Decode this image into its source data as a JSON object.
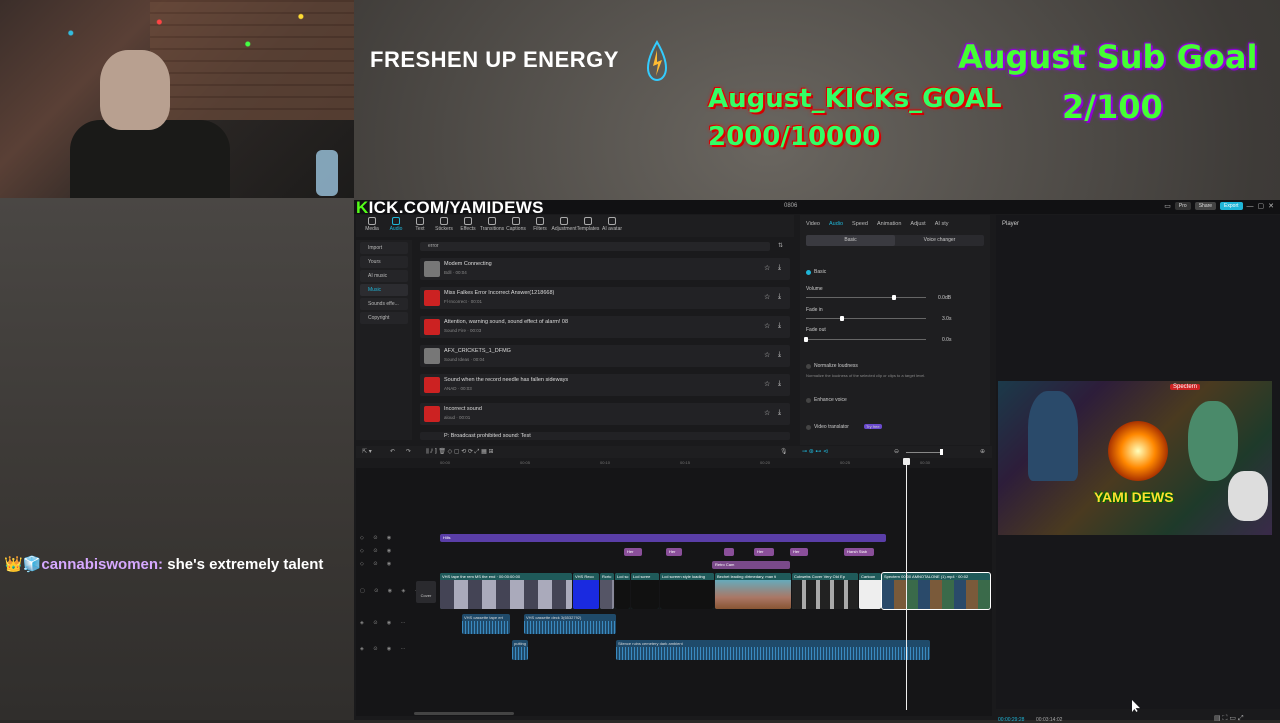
{
  "overlay": {
    "brand": "FRESHEN UP ENERGY",
    "kicks_goal_title": "August_KICKs_GOAL",
    "kicks_goal_value": "2000/10000",
    "sub_goal_title": "August Sub Goal",
    "sub_goal_value": "2/100",
    "kick_url_k": "K",
    "kick_url_rest": "ICK.COM/YAMIDEWS",
    "chat": {
      "badges": "👑🧊",
      "user": "cannabiswomen:",
      "message": " she's extremely talent"
    }
  },
  "editor": {
    "title": "0806",
    "top_buttons": {
      "pro": "Pro",
      "share": "Share",
      "export": "Export"
    },
    "toolbar": [
      "Media",
      "Audio",
      "Text",
      "Stickers",
      "Effects",
      "Transitions",
      "Captions",
      "Filters",
      "Adjustment",
      "Templates",
      "AI avatar"
    ],
    "sidebar": [
      "Import",
      "Yours",
      "AI music",
      "Music",
      "Sounds effe...",
      "Copyright"
    ],
    "search_value": "error",
    "sounds": [
      {
        "name": "Modem Connecting",
        "meta": "Bdll · 00:04",
        "thumb": "gray"
      },
      {
        "name": "Miss Falkes Error Incorrect Answer(1218668)",
        "meta": "Fl·Incorrect · 00:01",
        "thumb": "red"
      },
      {
        "name": "Attention, warning sound, sound effect of alarm! 08",
        "meta": "Sound Fire · 00:03",
        "thumb": "red"
      },
      {
        "name": "AFX_CRICKETS_1_DFMG",
        "meta": "Sound Ideas · 00:04",
        "thumb": "gray"
      },
      {
        "name": "Sound when the record needle has fallen sideways",
        "meta": "ANAD · 00:03",
        "thumb": "red"
      },
      {
        "name": "Incorrect sound",
        "meta": "aloud · 00:01",
        "thumb": "red"
      },
      {
        "name": "P: Broadcast prohibited sound: Test",
        "meta": "",
        "thumb": "red"
      }
    ],
    "props": {
      "tabs": [
        "Video",
        "Audio",
        "Speed",
        "Animation",
        "Adjust",
        "AI sty"
      ],
      "subtabs": [
        "Basic",
        "Voice changer"
      ],
      "basic": "Basic",
      "volume": "Volume",
      "volume_val": "0.0dB",
      "fade_in": "Fade in",
      "fade_in_val": "3.0s",
      "fade_out": "Fade out",
      "fade_out_val": "0.0s",
      "normalize": "Normalize loudness",
      "normalize_desc": "Normalize the loudness of the selected clip or clips to a target level.",
      "enhance": "Enhance voice",
      "translator": "Video translator",
      "translator_badge": "Try free"
    },
    "player": {
      "label": "Player",
      "current_time": "00:00:29:28",
      "total_time": "00:03:14:02",
      "preview_title": "YAMI DEWS",
      "preview_badge": "Spectern"
    },
    "ruler": [
      "00:00",
      "00:05",
      "00:10",
      "00:15",
      "00:20",
      "00:25",
      "00:30"
    ],
    "timeline": {
      "text_clip": "Hills",
      "sticker_clip": "Retro Cam",
      "small_clips": [
        "Her",
        "Her",
        "",
        "Her",
        "Her",
        "Harsh Stab"
      ],
      "video_clips": [
        "VHS tape the rem MS the end · 00:00:00:00",
        "VHS Reco",
        "Rcrtc",
        "Lcd sc",
        "Lcd scree",
        "Lcd screen style loading",
        "Bechet leading dirtmedary, man ti",
        "Cobwebs Cover Very Old Ep",
        "Cartoon",
        "Spectern 00:00 AMNOTALONE (1).mp4 · 00:02"
      ],
      "cover": "Cover",
      "audio_clips": [
        "VHS cassette tape ert",
        "VHS cassette deck 3(6532792)",
        "putting",
        "Silence ruins cemetery dark ambient"
      ]
    }
  },
  "colors": {
    "accent": "#1fb6d8",
    "kick_green": "#53fc18",
    "goal_green": "#33ff66"
  }
}
